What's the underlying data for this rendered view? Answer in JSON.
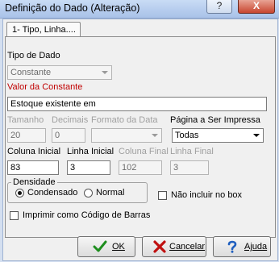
{
  "window": {
    "title": "Definição do Dado (Alteração)",
    "help_glyph": "?",
    "close_glyph": "X"
  },
  "tab": {
    "label": "1- Tipo, Linha...."
  },
  "tipo_dado": {
    "label": "Tipo de Dado",
    "value": "Constante"
  },
  "valor_constante": {
    "label": "Valor da Constante",
    "value": "Estoque existente em"
  },
  "tamanho": {
    "label": "Tamanho",
    "value": "20"
  },
  "decimais": {
    "label": "Decimais",
    "value": "0"
  },
  "formato_data": {
    "label": "Formato da Data",
    "value": ""
  },
  "pagina": {
    "label": "Página a Ser Impressa",
    "value": "Todas"
  },
  "coluna_inicial": {
    "label": "Coluna Inicial",
    "value": "83"
  },
  "linha_inicial": {
    "label": "Linha Inicial",
    "value": "3"
  },
  "coluna_final": {
    "label": "Coluna Final",
    "value": "102"
  },
  "linha_final": {
    "label": "Linha Final",
    "value": "3"
  },
  "densidade": {
    "label": "Densidade",
    "options": [
      {
        "label": "Condensado",
        "selected": true
      },
      {
        "label": "Normal",
        "selected": false
      }
    ]
  },
  "nao_incluir_box": {
    "label": "Não incluir no box",
    "checked": false
  },
  "codigo_barras": {
    "label": "Imprimir como Código de Barras",
    "checked": false
  },
  "buttons": {
    "ok": "OK",
    "cancelar": "Cancelar",
    "ajuda": "Ajuda"
  },
  "colors": {
    "required_label": "#c00000",
    "ok_icon": "#1e8e1e",
    "cancel_icon": "#c01010",
    "help_icon": "#1f5fbf"
  }
}
